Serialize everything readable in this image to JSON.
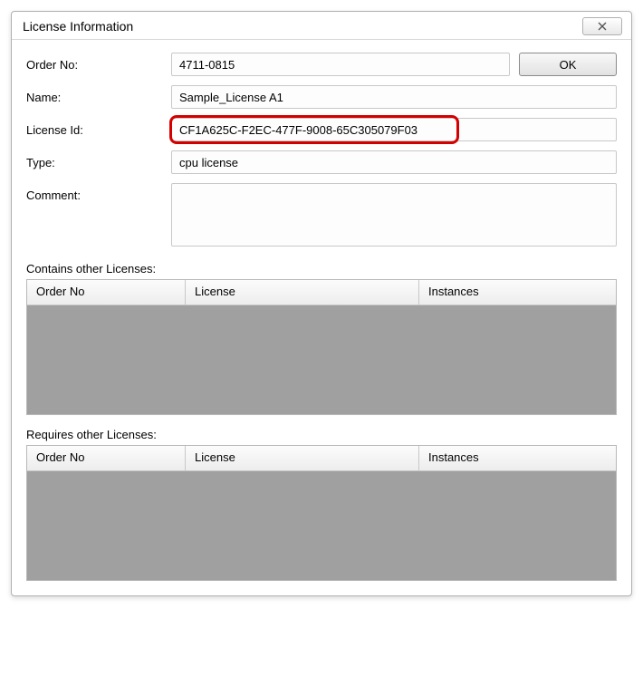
{
  "window": {
    "title": "License Information"
  },
  "buttons": {
    "ok": "OK"
  },
  "form": {
    "order_no_label": "Order No:",
    "order_no_value": "4711-0815",
    "name_label": "Name:",
    "name_value": "Sample_License A1",
    "license_id_label": "License Id:",
    "license_id_value": "CF1A625C-F2EC-477F-9008-65C305079F03",
    "type_label": "Type:",
    "type_value": "cpu license",
    "comment_label": "Comment:",
    "comment_value": ""
  },
  "sections": {
    "contains_label": "Contains other Licenses:",
    "requires_label": "Requires other Licenses:"
  },
  "table": {
    "col_order_no": "Order No",
    "col_license": "License",
    "col_instances": "Instances"
  }
}
